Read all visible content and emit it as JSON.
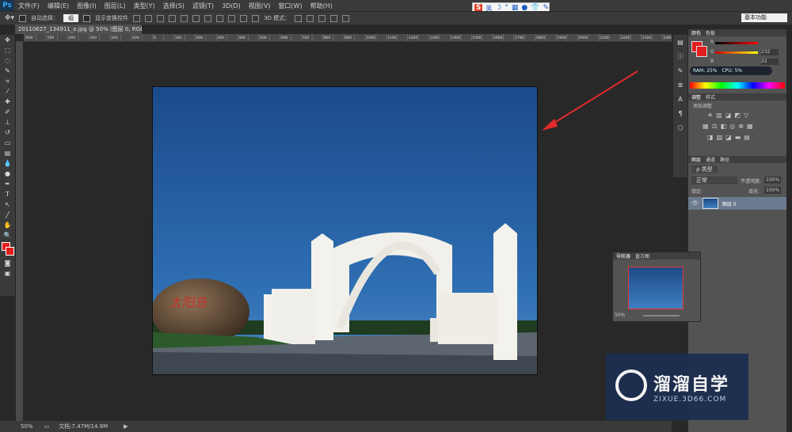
{
  "menubar": {
    "logo": "Ps",
    "items": [
      "文件(F)",
      "编辑(E)",
      "图像(I)",
      "图层(L)",
      "类型(Y)",
      "选择(S)",
      "滤镜(T)",
      "3D(D)",
      "视图(V)",
      "窗口(W)",
      "帮助(H)"
    ]
  },
  "ime": {
    "logo": "S",
    "text": "英"
  },
  "options": {
    "auto_select_label": "自动选择：",
    "auto_select_value": "组",
    "show_transform_label": "显示变换控件",
    "mode_3d_label": "3D 模式："
  },
  "workspace": "基本功能",
  "document": {
    "tab_title": "20110627_134911_e.jpg @ 50% (图层 0, RGB/8#) *",
    "ruler_ticks": [
      "600",
      "550",
      "500",
      "450",
      "400",
      "350",
      "300",
      "250",
      "200",
      "150",
      "100",
      "50",
      "0",
      "50",
      "100",
      "150",
      "200",
      "250",
      "300",
      "350",
      "400",
      "450",
      "500",
      "550",
      "600",
      "650",
      "700",
      "750",
      "800",
      "850",
      "900",
      "950",
      "1000",
      "1050",
      "1100",
      "1150",
      "1200",
      "1250",
      "1300",
      "1350",
      "1400",
      "1450",
      "1500",
      "1550",
      "1600",
      "1650",
      "1700",
      "1750",
      "1800",
      "1850",
      "1900",
      "1950",
      "2000",
      "2050",
      "2100",
      "2150",
      "2200",
      "2250",
      "2300",
      "2350",
      "2400"
    ],
    "rock_text": "太阳岛"
  },
  "status": {
    "zoom": "50%",
    "doc_size": "文档:7.47M/14.9M"
  },
  "color_panel": {
    "tabs": [
      "颜色",
      "色板"
    ],
    "channels": [
      {
        "label": "R",
        "value": ""
      },
      {
        "label": "G",
        "value": "232"
      },
      {
        "label": "B",
        "value": "22"
      }
    ],
    "ram": "RAM: 25%",
    "cpu": "CPU: 5%"
  },
  "adjust_panel": {
    "tabs": [
      "调整",
      "样式"
    ],
    "title": "添加调整"
  },
  "layers_panel": {
    "tabs": [
      "图层",
      "通道",
      "路径"
    ],
    "kind": "ρ 类型",
    "blend": "正常",
    "opacity_label": "不透明度:",
    "opacity": "100%",
    "lock_label": "锁定:",
    "fill_label": "填充:",
    "fill": "100%",
    "layer_name": "图层 0"
  },
  "navigator": {
    "tabs": [
      "导航器",
      "直方图"
    ],
    "zoom": "50%"
  },
  "watermark": {
    "name": "溜溜自学",
    "url": "ZIXUE.3D66.COM"
  }
}
